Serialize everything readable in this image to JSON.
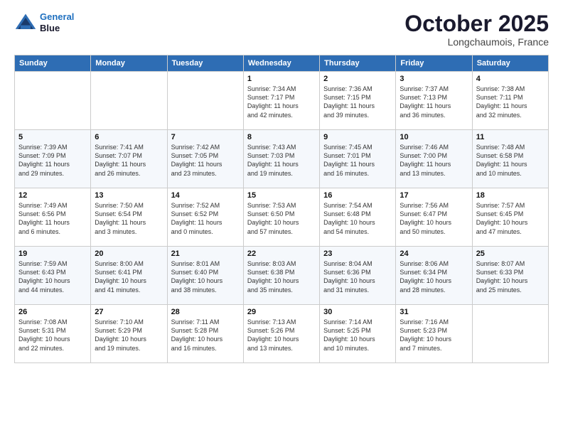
{
  "header": {
    "logo_line1": "General",
    "logo_line2": "Blue",
    "month": "October 2025",
    "location": "Longchaumois, France"
  },
  "weekdays": [
    "Sunday",
    "Monday",
    "Tuesday",
    "Wednesday",
    "Thursday",
    "Friday",
    "Saturday"
  ],
  "weeks": [
    [
      {
        "day": "",
        "info": ""
      },
      {
        "day": "",
        "info": ""
      },
      {
        "day": "",
        "info": ""
      },
      {
        "day": "1",
        "info": "Sunrise: 7:34 AM\nSunset: 7:17 PM\nDaylight: 11 hours\nand 42 minutes."
      },
      {
        "day": "2",
        "info": "Sunrise: 7:36 AM\nSunset: 7:15 PM\nDaylight: 11 hours\nand 39 minutes."
      },
      {
        "day": "3",
        "info": "Sunrise: 7:37 AM\nSunset: 7:13 PM\nDaylight: 11 hours\nand 36 minutes."
      },
      {
        "day": "4",
        "info": "Sunrise: 7:38 AM\nSunset: 7:11 PM\nDaylight: 11 hours\nand 32 minutes."
      }
    ],
    [
      {
        "day": "5",
        "info": "Sunrise: 7:39 AM\nSunset: 7:09 PM\nDaylight: 11 hours\nand 29 minutes."
      },
      {
        "day": "6",
        "info": "Sunrise: 7:41 AM\nSunset: 7:07 PM\nDaylight: 11 hours\nand 26 minutes."
      },
      {
        "day": "7",
        "info": "Sunrise: 7:42 AM\nSunset: 7:05 PM\nDaylight: 11 hours\nand 23 minutes."
      },
      {
        "day": "8",
        "info": "Sunrise: 7:43 AM\nSunset: 7:03 PM\nDaylight: 11 hours\nand 19 minutes."
      },
      {
        "day": "9",
        "info": "Sunrise: 7:45 AM\nSunset: 7:01 PM\nDaylight: 11 hours\nand 16 minutes."
      },
      {
        "day": "10",
        "info": "Sunrise: 7:46 AM\nSunset: 7:00 PM\nDaylight: 11 hours\nand 13 minutes."
      },
      {
        "day": "11",
        "info": "Sunrise: 7:48 AM\nSunset: 6:58 PM\nDaylight: 11 hours\nand 10 minutes."
      }
    ],
    [
      {
        "day": "12",
        "info": "Sunrise: 7:49 AM\nSunset: 6:56 PM\nDaylight: 11 hours\nand 6 minutes."
      },
      {
        "day": "13",
        "info": "Sunrise: 7:50 AM\nSunset: 6:54 PM\nDaylight: 11 hours\nand 3 minutes."
      },
      {
        "day": "14",
        "info": "Sunrise: 7:52 AM\nSunset: 6:52 PM\nDaylight: 11 hours\nand 0 minutes."
      },
      {
        "day": "15",
        "info": "Sunrise: 7:53 AM\nSunset: 6:50 PM\nDaylight: 10 hours\nand 57 minutes."
      },
      {
        "day": "16",
        "info": "Sunrise: 7:54 AM\nSunset: 6:48 PM\nDaylight: 10 hours\nand 54 minutes."
      },
      {
        "day": "17",
        "info": "Sunrise: 7:56 AM\nSunset: 6:47 PM\nDaylight: 10 hours\nand 50 minutes."
      },
      {
        "day": "18",
        "info": "Sunrise: 7:57 AM\nSunset: 6:45 PM\nDaylight: 10 hours\nand 47 minutes."
      }
    ],
    [
      {
        "day": "19",
        "info": "Sunrise: 7:59 AM\nSunset: 6:43 PM\nDaylight: 10 hours\nand 44 minutes."
      },
      {
        "day": "20",
        "info": "Sunrise: 8:00 AM\nSunset: 6:41 PM\nDaylight: 10 hours\nand 41 minutes."
      },
      {
        "day": "21",
        "info": "Sunrise: 8:01 AM\nSunset: 6:40 PM\nDaylight: 10 hours\nand 38 minutes."
      },
      {
        "day": "22",
        "info": "Sunrise: 8:03 AM\nSunset: 6:38 PM\nDaylight: 10 hours\nand 35 minutes."
      },
      {
        "day": "23",
        "info": "Sunrise: 8:04 AM\nSunset: 6:36 PM\nDaylight: 10 hours\nand 31 minutes."
      },
      {
        "day": "24",
        "info": "Sunrise: 8:06 AM\nSunset: 6:34 PM\nDaylight: 10 hours\nand 28 minutes."
      },
      {
        "day": "25",
        "info": "Sunrise: 8:07 AM\nSunset: 6:33 PM\nDaylight: 10 hours\nand 25 minutes."
      }
    ],
    [
      {
        "day": "26",
        "info": "Sunrise: 7:08 AM\nSunset: 5:31 PM\nDaylight: 10 hours\nand 22 minutes."
      },
      {
        "day": "27",
        "info": "Sunrise: 7:10 AM\nSunset: 5:29 PM\nDaylight: 10 hours\nand 19 minutes."
      },
      {
        "day": "28",
        "info": "Sunrise: 7:11 AM\nSunset: 5:28 PM\nDaylight: 10 hours\nand 16 minutes."
      },
      {
        "day": "29",
        "info": "Sunrise: 7:13 AM\nSunset: 5:26 PM\nDaylight: 10 hours\nand 13 minutes."
      },
      {
        "day": "30",
        "info": "Sunrise: 7:14 AM\nSunset: 5:25 PM\nDaylight: 10 hours\nand 10 minutes."
      },
      {
        "day": "31",
        "info": "Sunrise: 7:16 AM\nSunset: 5:23 PM\nDaylight: 10 hours\nand 7 minutes."
      },
      {
        "day": "",
        "info": ""
      }
    ]
  ]
}
